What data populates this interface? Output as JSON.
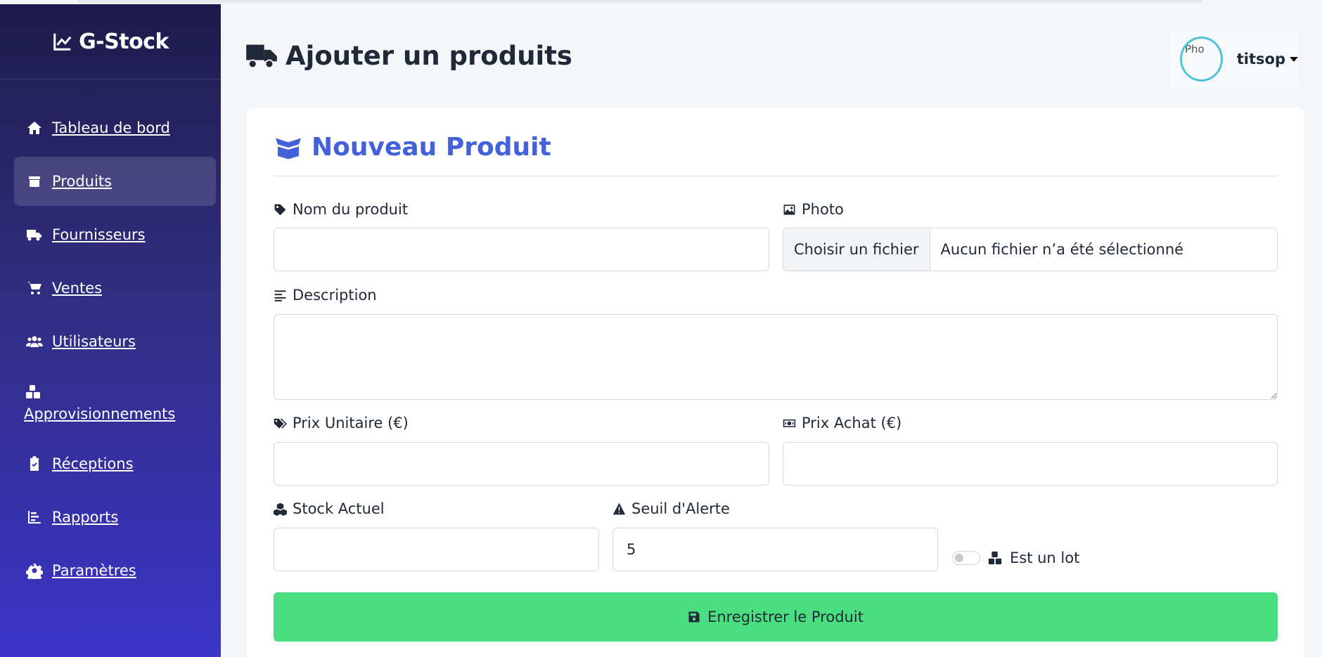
{
  "brand": {
    "name": "G-Stock"
  },
  "sidebar": {
    "items": [
      {
        "label": "Tableau de bord",
        "icon": "home-icon"
      },
      {
        "label": "Produits",
        "icon": "box-icon",
        "active": true
      },
      {
        "label": "Fournisseurs",
        "icon": "truck-icon"
      },
      {
        "label": "Ventes",
        "icon": "cart-icon"
      },
      {
        "label": "Utilisateurs",
        "icon": "users-icon"
      },
      {
        "label": "Approvisionnements",
        "icon": "boxes-icon"
      },
      {
        "label": "Réceptions",
        "icon": "clipboard-check-icon"
      },
      {
        "label": "Rapports",
        "icon": "chart-icon"
      },
      {
        "label": "Paramètres",
        "icon": "gear-icon"
      }
    ]
  },
  "header": {
    "title": "Ajouter un produits",
    "user": {
      "name": "titsop",
      "avatar_alt": "Pho"
    }
  },
  "form": {
    "title": "Nouveau Produit",
    "name_label": "Nom du produit",
    "name_value": "",
    "photo_label": "Photo",
    "photo_button": "Choisir un fichier",
    "photo_status": "Aucun fichier n’a été sélectionné",
    "description_label": "Description",
    "description_value": "",
    "unit_price_label": "Prix Unitaire (€)",
    "unit_price_value": "",
    "purchase_price_label": "Prix Achat (€)",
    "purchase_price_value": "",
    "stock_label": "Stock Actuel",
    "stock_value": "",
    "alert_label": "Seuil d'Alerte",
    "alert_value": "5",
    "lot_label": "Est un lot",
    "lot_checked": false,
    "submit_label": "Enregistrer le Produit"
  },
  "colors": {
    "accent": "#4361d8",
    "submit": "#4ade80",
    "sidebar_top": "#1e1b4b",
    "sidebar_bottom": "#3b34c8"
  }
}
